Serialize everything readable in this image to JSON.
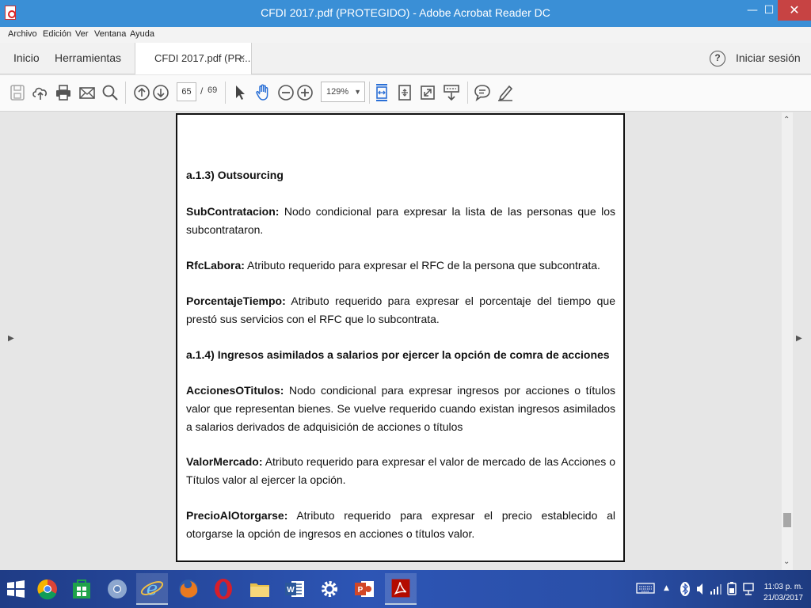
{
  "window": {
    "title": "CFDI 2017.pdf (PROTEGIDO) - Adobe Acrobat Reader DC"
  },
  "menu": [
    "Archivo",
    "Edición",
    "Ver",
    "Ventana",
    "Ayuda"
  ],
  "tabs": {
    "home": "Inicio",
    "tools": "Herramientas",
    "document": "CFDI 2017.pdf (PR...",
    "close": "×"
  },
  "account": {
    "help": "?",
    "signin": "Iniciar sesión"
  },
  "toolbar": {
    "page_current": "65",
    "page_separator": "/",
    "page_total": "69",
    "zoom": "129%",
    "icons": [
      "save-icon",
      "upload-icon",
      "print-icon",
      "email-icon",
      "search-icon",
      "page-up-icon",
      "page-down-icon",
      "select-cursor-icon",
      "hand-tool-icon",
      "zoom-out-icon",
      "zoom-in-icon",
      "fit-width-icon",
      "rotate-icon",
      "fullscreen-icon",
      "read-mode-icon",
      "comment-icon",
      "sign-icon"
    ]
  },
  "document": {
    "heading1": "a.1.3) Outsourcing",
    "p1_term": "SubContratacion:",
    "p1_text": " Nodo condicional para expresar la lista de las personas que los subcontrataron.",
    "p2_term": "RfcLabora:",
    "p2_text": " Atributo requerido para expresar el RFC de la persona que subcontrata.",
    "p3_term": "PorcentajeTiempo:",
    "p3_text": " Atributo requerido para expresar el porcentaje del tiempo que prestó sus servicios con el RFC que lo subcontrata.",
    "heading2": "a.1.4) Ingresos asimilados a salarios por ejercer la opción de comra de acciones",
    "p4_term": "AccionesOTitulos:",
    "p4_text": " Nodo condicional para expresar ingresos por acciones o títulos valor que representan bienes. Se vuelve requerido cuando existan ingresos asimilados a salarios derivados de adquisición de acciones o títulos",
    "p5_term": "ValorMercado:",
    "p5_text": " Atributo requerido para expresar el valor de mercado de las Acciones o Títulos valor al ejercer la opción.",
    "p6_term": "PrecioAlOtorgarse:",
    "p6_text": " Atributo requerido para expresar el precio establecido al otorgarse la opción de ingresos en acciones o títulos valor."
  },
  "taskbar": {
    "apps": [
      "windows-start",
      "chrome",
      "store",
      "chrome-alt",
      "internet-explorer",
      "firefox",
      "opera",
      "file-explorer",
      "word",
      "settings",
      "powerpoint",
      "acrobat"
    ],
    "time": "11:03 p. m.",
    "date": "21/03/2017"
  },
  "colors": {
    "titlebar": "#3a8fd6",
    "close": "#c74343",
    "accent_blue": "#2a6fd6",
    "taskbar": "#2d55b5"
  }
}
